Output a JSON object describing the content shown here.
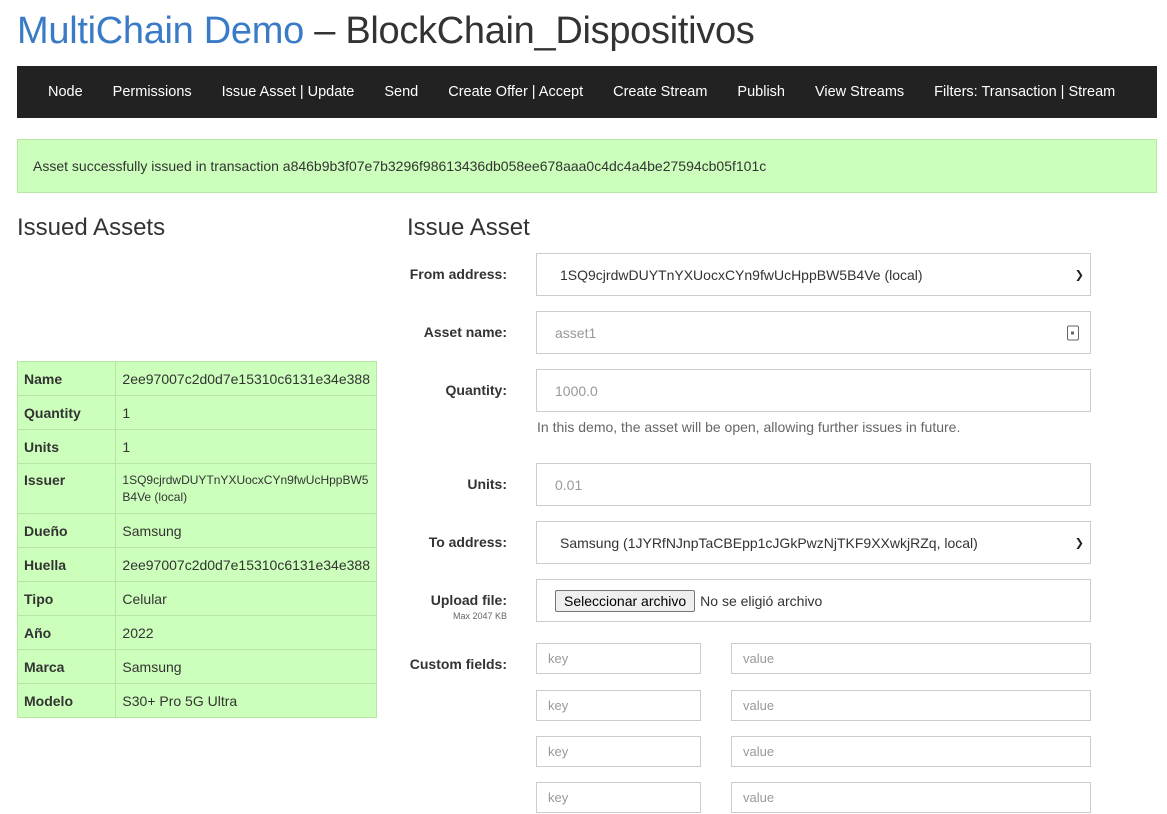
{
  "header": {
    "brand": "MultiChain Demo",
    "separator": " – ",
    "chain_name": "BlockChain_Dispositivos"
  },
  "nav": [
    {
      "label": "Node"
    },
    {
      "label": "Permissions"
    },
    {
      "label": "Issue Asset | Update"
    },
    {
      "label": "Send"
    },
    {
      "label": "Create Offer | Accept"
    },
    {
      "label": "Create Stream"
    },
    {
      "label": "Publish"
    },
    {
      "label": "View Streams"
    },
    {
      "label": "Filters: Transaction | Stream"
    }
  ],
  "alert": {
    "text": "Asset successfully issued in transaction a846b9b3f07e7b3296f98613436db058ee678aaa0c4dc4a4be27594cb05f101c",
    "color": "#ccffbb"
  },
  "issued_assets": {
    "title": "Issued Assets",
    "rows": [
      {
        "key": "Name",
        "value": "2ee97007c2d0d7e15310c6131e34e388"
      },
      {
        "key": "Quantity",
        "value": "1"
      },
      {
        "key": "Units",
        "value": "1"
      },
      {
        "key": "Issuer",
        "value": "1SQ9cjrdwDUYTnYXUocxCYn9fwUcHppBW5B4Ve (local)"
      },
      {
        "key": "Dueño",
        "value": "Samsung"
      },
      {
        "key": "Huella",
        "value": "2ee97007c2d0d7e15310c6131e34e388"
      },
      {
        "key": "Tipo",
        "value": "Celular"
      },
      {
        "key": "Año",
        "value": "2022"
      },
      {
        "key": "Marca",
        "value": "Samsung"
      },
      {
        "key": "Modelo",
        "value": "S30+ Pro 5G Ultra"
      }
    ]
  },
  "issue_form": {
    "title": "Issue Asset",
    "from_label": "From address:",
    "from_value": "1SQ9cjrdwDUYTnYXUocxCYn9fwUcHppBW5B4Ve (local)",
    "name_label": "Asset name:",
    "name_placeholder": "asset1",
    "quantity_label": "Quantity:",
    "quantity_placeholder": "1000.0",
    "quantity_help": "In this demo, the asset will be open, allowing further issues in future.",
    "units_label": "Units:",
    "units_placeholder": "0.01",
    "to_label": "To address:",
    "to_value": "Samsung (1JYRfNJnpTaCBEpp1cJGkPwzNjTKF9XXwkjRZq, local)",
    "upload_label": "Upload file:",
    "upload_hint": "Max 2047 KB",
    "upload_button": "Seleccionar archivo",
    "upload_status": "No se eligió archivo",
    "custom_label": "Custom fields:",
    "custom_fields": [
      {
        "key": "key",
        "value": "value"
      },
      {
        "key": "key",
        "value": "value"
      },
      {
        "key": "key",
        "value": "value"
      },
      {
        "key": "key",
        "value": "value"
      }
    ]
  }
}
